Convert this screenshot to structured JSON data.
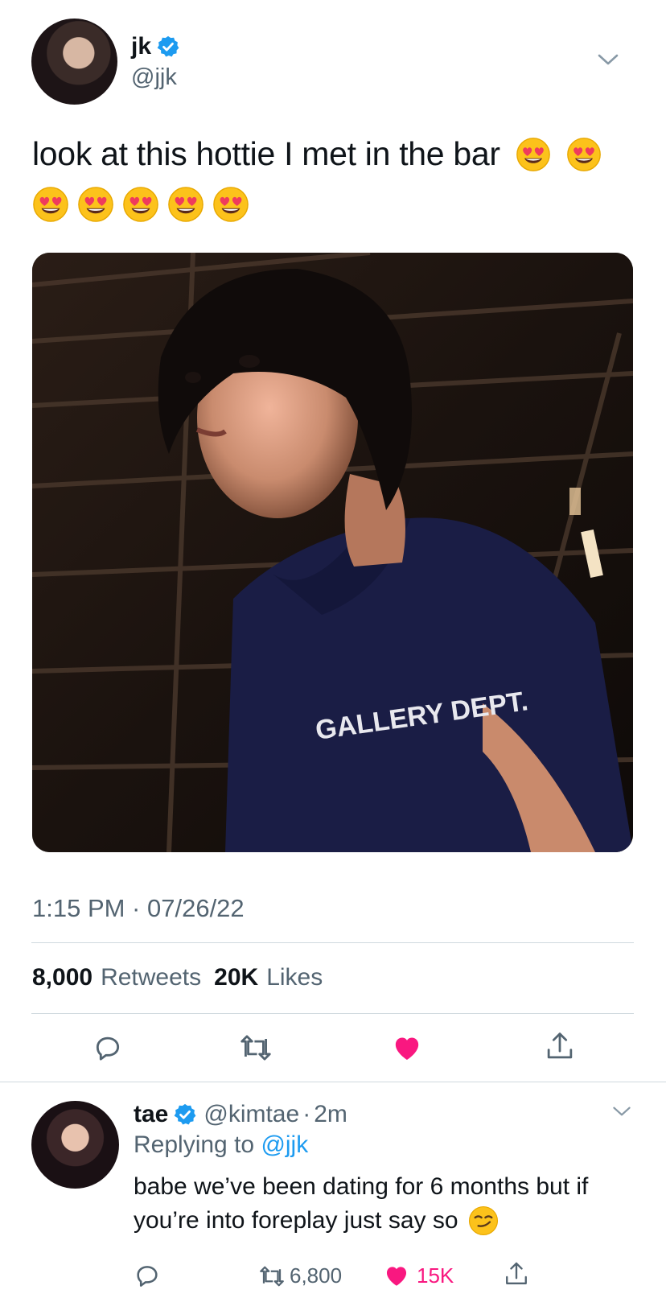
{
  "tweet": {
    "display_name": "jk",
    "handle": "@jjk",
    "text": "look at this hottie I met in the bar",
    "emoji_count": 7,
    "photo_print": "GALLERY DEPT.",
    "time": "1:15 PM · 07/26/22",
    "retweets_count": "8,000",
    "retweets_label": "Retweets",
    "likes_count": "20K",
    "likes_label": "Likes",
    "liked": true
  },
  "reply": {
    "display_name": "tae",
    "handle": "@kimtae",
    "time": "2m",
    "replying_to_prefix": "Replying to",
    "replying_to_handle": "@jjk",
    "text_line1": "babe we’ve been dating for 6 months but if",
    "text_line2": "you’re into foreplay just say so",
    "retweets": "6,800",
    "likes": "15K"
  },
  "icons": {
    "verified": "verified-badge-icon",
    "caret": "chevron-down-icon",
    "reply": "reply-icon",
    "retweet": "retweet-icon",
    "like": "heart-icon",
    "share": "share-icon",
    "heart_eyes": "heart-eyes-emoji",
    "smirk": "smirk-emoji"
  },
  "colors": {
    "verified": "#1d9bf0",
    "like": "#f91880",
    "text": "#0f1419",
    "muted": "#536471"
  }
}
